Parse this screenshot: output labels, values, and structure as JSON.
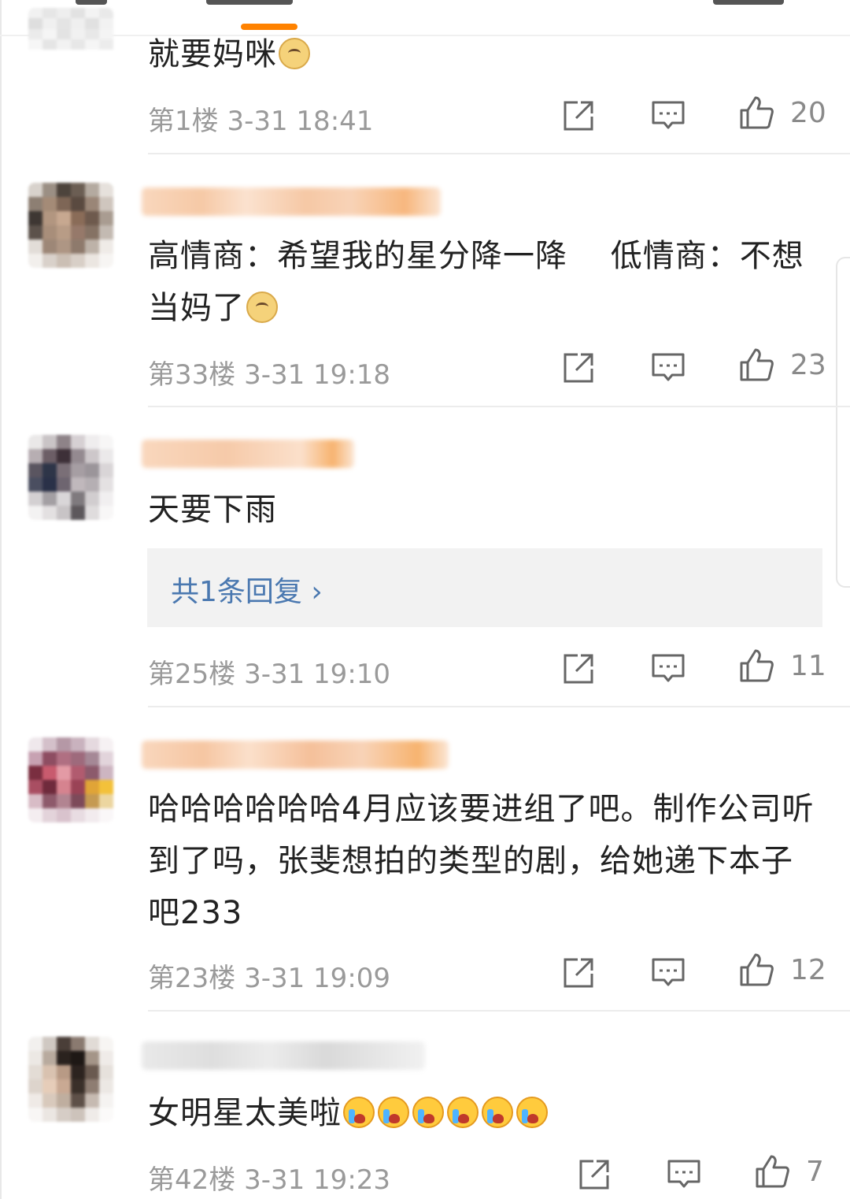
{
  "colors": {
    "accent": "#ff8200",
    "reply_link": "#4a78b0",
    "meta": "#9a9a9a",
    "text": "#222222"
  },
  "icons": {
    "share": "share-icon",
    "comment": "comment-icon",
    "like": "thumbs-up-icon"
  },
  "comments": [
    {
      "text": "就要妈咪",
      "emojis": [
        "doge"
      ],
      "floor": "第1楼",
      "time": "3-31 18:41",
      "likes": "20"
    },
    {
      "text": "高情商：希望我的星分降一降　 低情商：不想当妈了",
      "emojis": [
        "doge"
      ],
      "floor": "第33楼",
      "time": "3-31 19:18",
      "likes": "23"
    },
    {
      "text": "天要下雨",
      "reply_label": "共1条回复 ›",
      "floor": "第25楼",
      "time": "3-31 19:10",
      "likes": "11"
    },
    {
      "text": "哈哈哈哈哈哈4月应该要进组了吧。制作公司听到了吗，张斐想拍的类型的剧，给她递下本子吧233",
      "floor": "第23楼",
      "time": "3-31 19:09",
      "likes": "12"
    },
    {
      "text": "女明星太美啦",
      "emojis": [
        "cry",
        "cry",
        "cry",
        "cry",
        "cry",
        "cry"
      ],
      "floor": "第42楼",
      "time": "3-31 19:23",
      "likes": "7"
    }
  ]
}
